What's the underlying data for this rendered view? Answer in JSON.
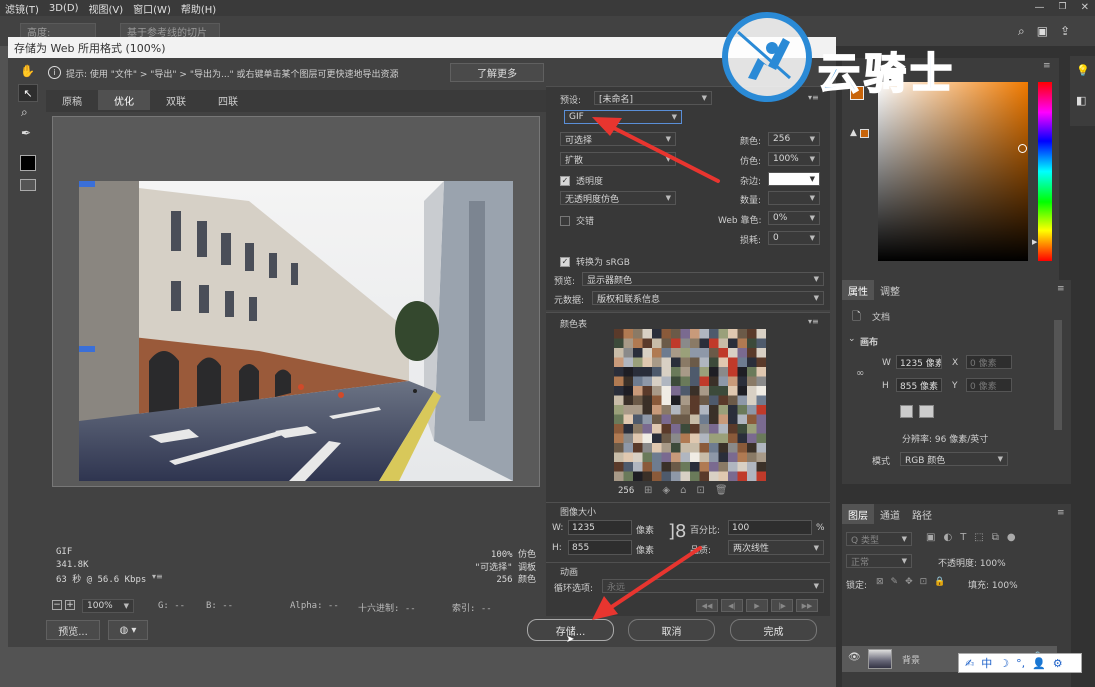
{
  "menu": [
    "滤镜(T)",
    "3D(D)",
    "视图(V)",
    "窗口(W)",
    "帮助(H)"
  ],
  "optbar": {
    "field1": "高度:",
    "field2": "基于参考线的切片"
  },
  "dialog": {
    "title": "存储为 Web 所用格式 (100%)",
    "hint": "提示: 使用 \"文件\" > \"导出\" > \"导出为...\" 或右键单击某个图层可更快速地导出资源",
    "learn_more": "了解更多",
    "tabs": [
      "原稿",
      "优化",
      "双联",
      "四联"
    ],
    "active_tab": "优化",
    "preview_info": {
      "left": [
        "GIF",
        "341.8K",
        "63 秒 @ 56.6 Kbps"
      ],
      "right": [
        "100% 仿色",
        "\"可选择\" 调板",
        "256 颜色"
      ]
    },
    "status": {
      "zoom": "100%",
      "g": "G: --",
      "b": "B: --",
      "alpha": "Alpha: --",
      "hex": "十六进制: --",
      "index": "索引: --"
    },
    "preview_button": "预览...",
    "preset_label": "预设:",
    "preset_value": "[未命名]",
    "format": "GIF",
    "reduction": "可选择",
    "dither_algo": "扩散",
    "transparency_label": "透明度",
    "transparency_dither": "无透明度仿色",
    "interlace_label": "交错",
    "colors_label": "颜色:",
    "colors_value": "256",
    "dither_label": "仿色:",
    "dither_value": "100%",
    "matte_label": "杂边:",
    "amount_label": "数量:",
    "websnap_label": "Web 靠色:",
    "websnap_value": "0%",
    "lossy_label": "损耗:",
    "lossy_value": "0",
    "convert_srgb": "转换为 sRGB",
    "preview_label": "预览:",
    "preview_value": "显示器颜色",
    "metadata_label": "元数据:",
    "metadata_value": "版权和联系信息",
    "color_table_label": "颜色表",
    "color_count": "256",
    "image_size_label": "图像大小",
    "w_label": "W:",
    "w_value": "1235",
    "h_label": "H:",
    "h_value": "855",
    "unit": "像素",
    "percent_label": "百分比:",
    "percent_value": "100",
    "percent_unit": "%",
    "quality_label": "品质:",
    "quality_value": "两次线性",
    "animation_label": "动画",
    "loop_label": "循环选项:",
    "loop_value": "永远",
    "save_button": "存储...",
    "cancel_button": "取消",
    "done_button": "完成"
  },
  "watermark": "云骑士",
  "ps": {
    "properties_tab": "属性",
    "adjust_tab": "调整",
    "doc_label": "文档",
    "canvas_label": "画布",
    "w_label": "W",
    "w_value": "1235 像素",
    "h_label": "H",
    "h_value": "855 像素",
    "x_label": "X",
    "x_value": "0 像素",
    "y_label": "Y",
    "y_value": "0 像素",
    "resolution": "分辨率: 96 像素/英寸",
    "mode_label": "模式",
    "mode_value": "RGB 颜色",
    "layers_tabs": [
      "图层",
      "通道",
      "路径"
    ],
    "kind": "Q 类型",
    "blend": "正常",
    "opacity": "不透明度: 100%",
    "lock": "锁定:",
    "fill": "填充: 100%",
    "layer_name": "背景"
  },
  "ime": [
    "中"
  ],
  "colors": {
    "accent_blue": "#2a8ad6",
    "foreground": "#c8640a",
    "arrow_red": "#e8352f"
  }
}
